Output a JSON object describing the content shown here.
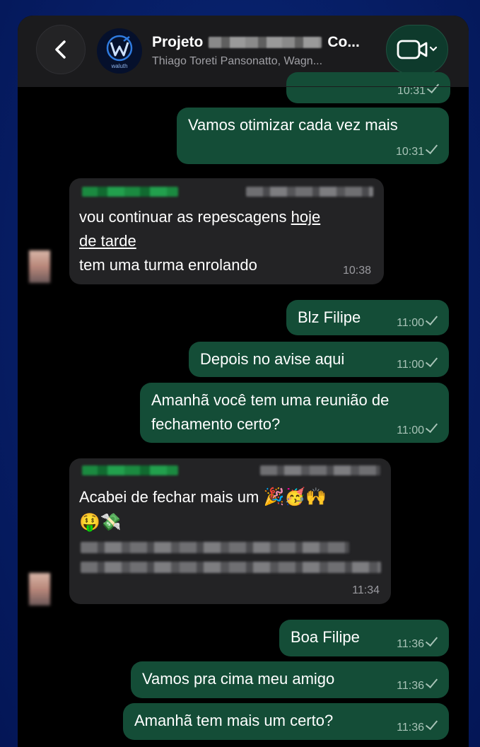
{
  "header": {
    "title_start": "Projeto",
    "title_end": "Co...",
    "subtitle": "Thiago Toreti Pansonatto, Wagn...",
    "avatar_text": "waluth"
  },
  "messages": {
    "m0_time": "10:31",
    "m1_text": "Vamos otimizar cada vez mais",
    "m1_time": "10:31",
    "m2_line1_a": "vou continuar as repescagens ",
    "m2_line1_b": "hoje",
    "m2_line2": "de tarde",
    "m2_line3": "tem uma turma enrolando",
    "m2_time": "10:38",
    "m3_text": "Blz Filipe",
    "m3_time": "11:00",
    "m4_text": "Depois no avise aqui",
    "m4_time": "11:00",
    "m5_line1": "Amanhã você tem uma reunião de",
    "m5_line2": "fechamento certo?",
    "m5_time": "11:00",
    "m6_line1": "Acabei de fechar mais um",
    "m6_emojis1": "🎉🥳🙌",
    "m6_emojis2": "🤑💸",
    "m6_time": "11:34",
    "m7_text": "Boa Filipe",
    "m7_time": "11:36",
    "m8_text": "Vamos pra cima meu amigo",
    "m8_time": "11:36",
    "m9_text": "Amanhã tem mais um certo?",
    "m9_time": "11:36"
  },
  "colors": {
    "outgoing_bubble": "#144d37",
    "incoming_bubble": "#232325",
    "background": "#000000",
    "page_gradient": "#07206a"
  },
  "icons": {
    "back": "chevron-left-icon",
    "video": "video-camera-icon",
    "read": "check-icon"
  }
}
